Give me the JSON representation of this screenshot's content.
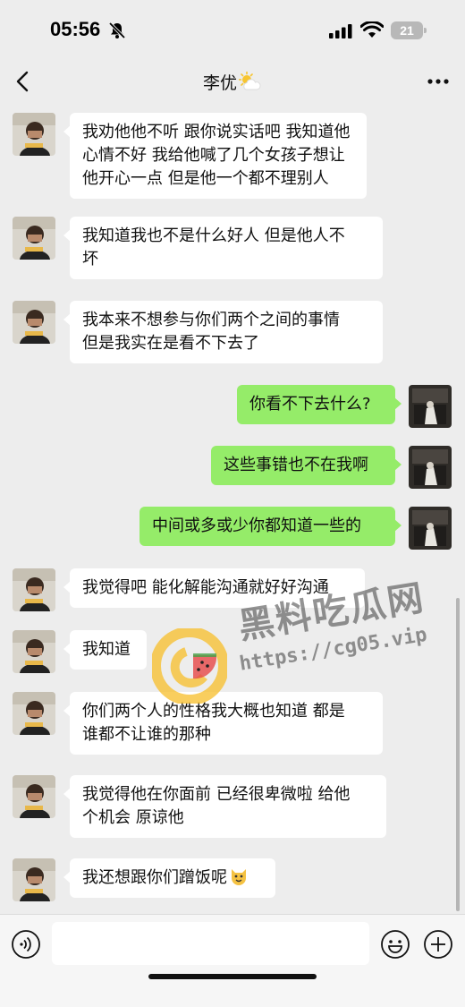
{
  "status_bar": {
    "time": "05:56",
    "battery": "21"
  },
  "nav": {
    "title": "李优"
  },
  "messages": [
    {
      "side": "in",
      "lines": [
        "我劝他他不听  跟你说实话吧 我知道他",
        "心情不好 我给他喊了几个女孩子想让",
        "他开心一点 但是他一个都不理别人"
      ]
    },
    {
      "side": "in",
      "lines": [
        "我知道我也不是什么好人 但是他人不",
        "坏"
      ]
    },
    {
      "side": "in",
      "lines": [
        "我本来不想参与你们两个之间的事情",
        "但是我实在是看不下去了"
      ]
    },
    {
      "side": "out",
      "lines": [
        "你看不下去什么?"
      ]
    },
    {
      "side": "out",
      "lines": [
        "这些事错也不在我啊"
      ]
    },
    {
      "side": "out",
      "lines": [
        "中间或多或少你都知道一些的"
      ]
    },
    {
      "side": "in",
      "lines": [
        "我觉得吧 能化解能沟通就好好沟通"
      ]
    },
    {
      "side": "in",
      "lines": [
        "我知道"
      ]
    },
    {
      "side": "in",
      "lines": [
        "你们两个人的性格我大概也知道 都是",
        "谁都不让谁的那种"
      ]
    },
    {
      "side": "in",
      "lines": [
        "我觉得他在你面前 已经很卑微啦 给他",
        "个机会  原谅他"
      ]
    },
    {
      "side": "in",
      "lines": [
        "我还想跟你们蹭饭呢"
      ]
    }
  ],
  "watermark": {
    "title": "黑料吃瓜网",
    "url": "https://cg05.vip"
  },
  "input": {
    "placeholder": ""
  },
  "colors": {
    "background": "#ededed",
    "incoming_bubble": "#ffffff",
    "outgoing_bubble": "#95ec69"
  }
}
